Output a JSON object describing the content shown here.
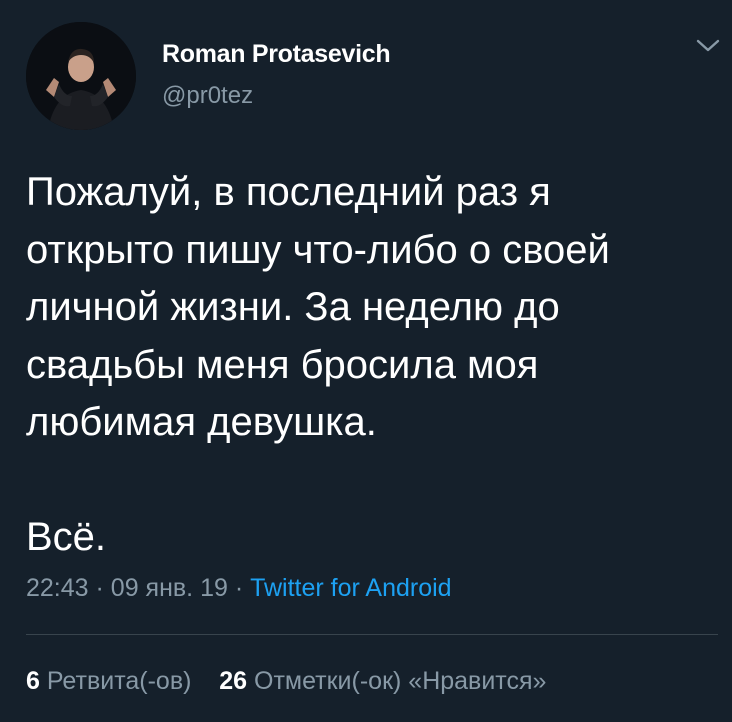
{
  "tweet": {
    "author_name": "Roman Protasevich",
    "author_handle": "@pr0tez",
    "body": "Пожалуй, в последний раз я\nоткрыто пишу что-либо о своей\nличной жизни. За неделю до\nсвадьбы меня бросила моя\nлюбимая девушка.\n\nВсё.",
    "time": "22:43",
    "date": "09 янв. 19",
    "separator": "·",
    "source": "Twitter for Android",
    "retweets_count": "6",
    "retweets_label": "Ретвита(-ов)",
    "likes_count": "26",
    "likes_label": "Отметки(-ок) «Нравится»"
  },
  "icons": {
    "menu": "chevron-down-icon",
    "avatar": "avatar"
  },
  "colors": {
    "background": "#15202b",
    "secondary_text": "#8899a6",
    "accent": "#1da1f2",
    "divider": "#38444d"
  }
}
